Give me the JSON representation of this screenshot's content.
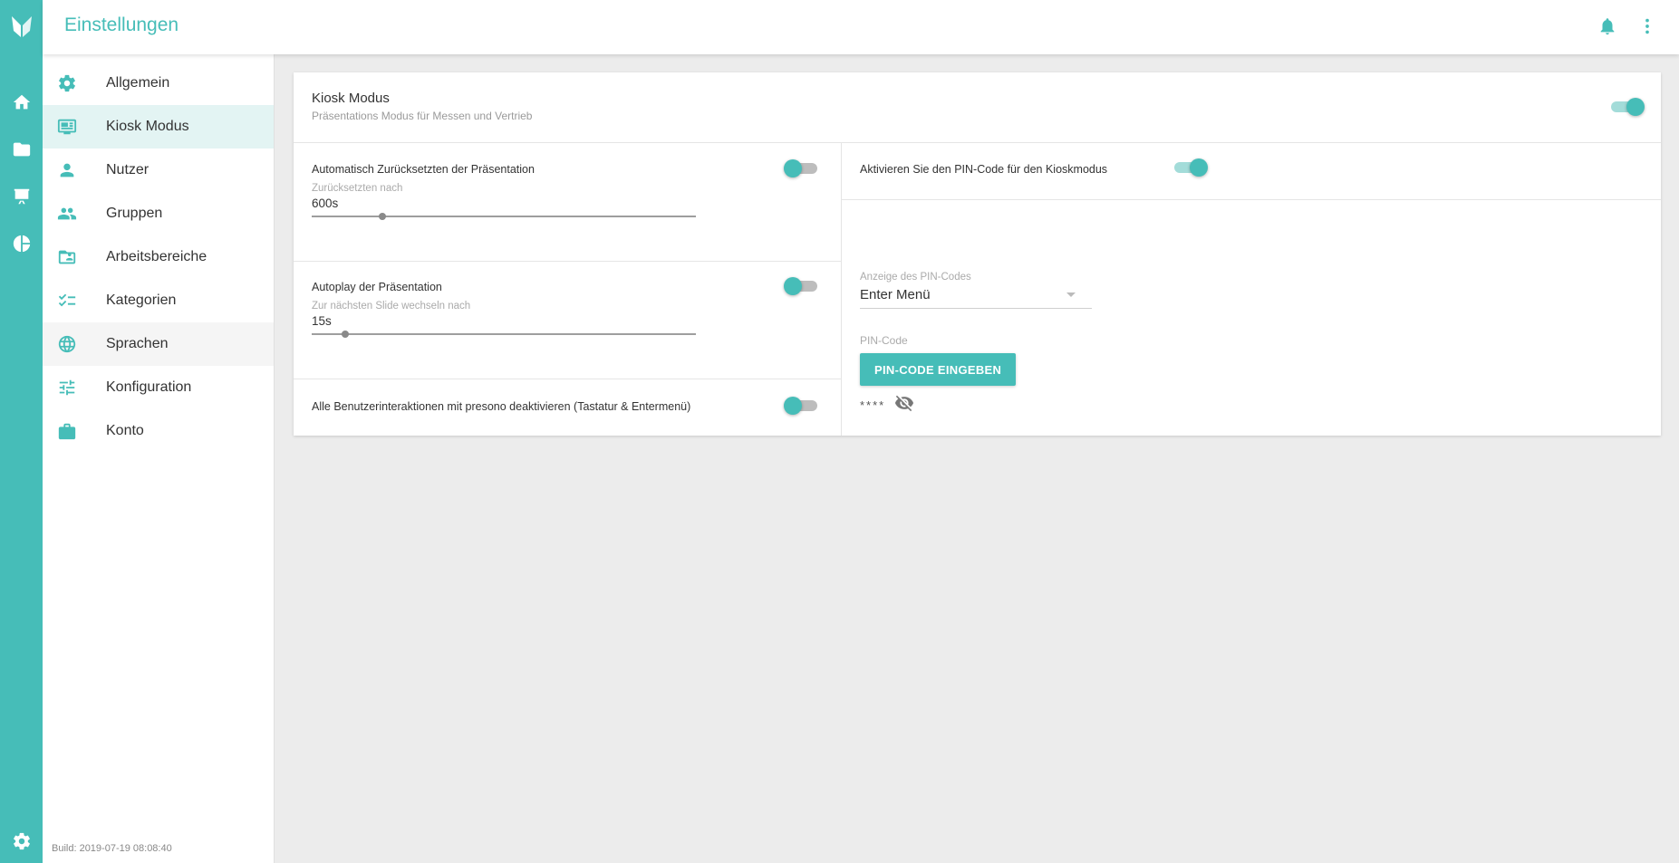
{
  "app": {
    "title": "Einstellungen",
    "build": "Build: 2019-07-19 08:08:40"
  },
  "colors": {
    "accent": "#46bdb8",
    "accent_light": "#e3f4f3"
  },
  "rail": {
    "icons": [
      "fox-logo-icon",
      "home-icon",
      "folder-icon",
      "presentation-icon",
      "pie-chart-icon",
      "settings-gear-icon"
    ]
  },
  "topbar": {
    "icons": [
      "bell-icon",
      "more-vertical-icon"
    ]
  },
  "menu": {
    "items": [
      {
        "label": "Allgemein",
        "icon": "gear-icon",
        "state": "normal"
      },
      {
        "label": "Kiosk Modus",
        "icon": "monitor-icon",
        "state": "active"
      },
      {
        "label": "Nutzer",
        "icon": "person-icon",
        "state": "normal"
      },
      {
        "label": "Gruppen",
        "icon": "people-icon",
        "state": "normal"
      },
      {
        "label": "Arbeitsbereiche",
        "icon": "folder-shared-icon",
        "state": "normal"
      },
      {
        "label": "Kategorien",
        "icon": "checklist-icon",
        "state": "normal"
      },
      {
        "label": "Sprachen",
        "icon": "globe-icon",
        "state": "hover"
      },
      {
        "label": "Konfiguration",
        "icon": "tune-icon",
        "state": "normal"
      },
      {
        "label": "Konto",
        "icon": "briefcase-icon",
        "state": "normal"
      }
    ]
  },
  "kiosk": {
    "title": "Kiosk Modus",
    "subtitle": "Präsentations Modus für Messen und Vertrieb",
    "enabled": true,
    "auto_reset": {
      "label": "Automatisch Zurücksetzten der Präsentation",
      "enabled": false,
      "field_label": "Zurücksetzten nach",
      "value": "600s",
      "slider_fraction": 0.185
    },
    "autoplay": {
      "label": "Autoplay der Präsentation",
      "enabled": false,
      "field_label": "Zur nächsten Slide wechseln nach",
      "value": "15s",
      "slider_fraction": 0.087
    },
    "disable_interactions": {
      "label": "Alle Benutzerinteraktionen mit presono deaktivieren (Tastatur & Entermenü)",
      "enabled": false
    },
    "pin": {
      "label": "Aktivieren Sie den PIN-Code für den Kioskmodus",
      "enabled": true,
      "display_label": "Anzeige des PIN-Codes",
      "display_value": "Enter Menü",
      "code_label": "PIN-Code",
      "button_label": "PIN-CODE EINGEBEN",
      "masked_value": "****"
    }
  }
}
